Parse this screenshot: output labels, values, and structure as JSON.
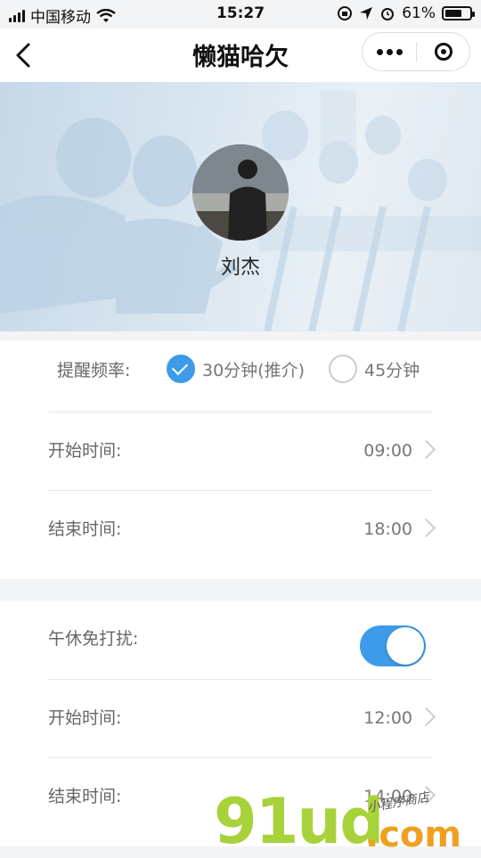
{
  "status_bar": {
    "carrier": "中国移动",
    "time": "15:27",
    "battery": "61%",
    "battery_level": 0.61
  },
  "nav": {
    "title": "懒猫哈欠",
    "icons": [
      "chevron-left-icon",
      "more-dots-icon",
      "close-target-icon"
    ]
  },
  "profile": {
    "name": "刘杰"
  },
  "reminder": {
    "label": "提醒频率:",
    "options": [
      {
        "label": "30分钟(推介)",
        "selected": true
      },
      {
        "label": "45分钟",
        "selected": false
      }
    ],
    "start_label": "开始时间:",
    "start_value": "09:00",
    "end_label": "结束时间:",
    "end_value": "18:00"
  },
  "nap": {
    "label": "午休免打扰:",
    "enabled": true,
    "start_label": "开始时间:",
    "start_value": "12:00",
    "end_label": "结束时间:",
    "end_value": "14:00"
  },
  "watermark": {
    "brand": "91ud",
    "domain": ".com",
    "tagline": "小程序商店"
  },
  "colors": {
    "accent": "#3d9be9",
    "watermark_green": "#a8d23a",
    "watermark_orange": "#f0a020"
  }
}
